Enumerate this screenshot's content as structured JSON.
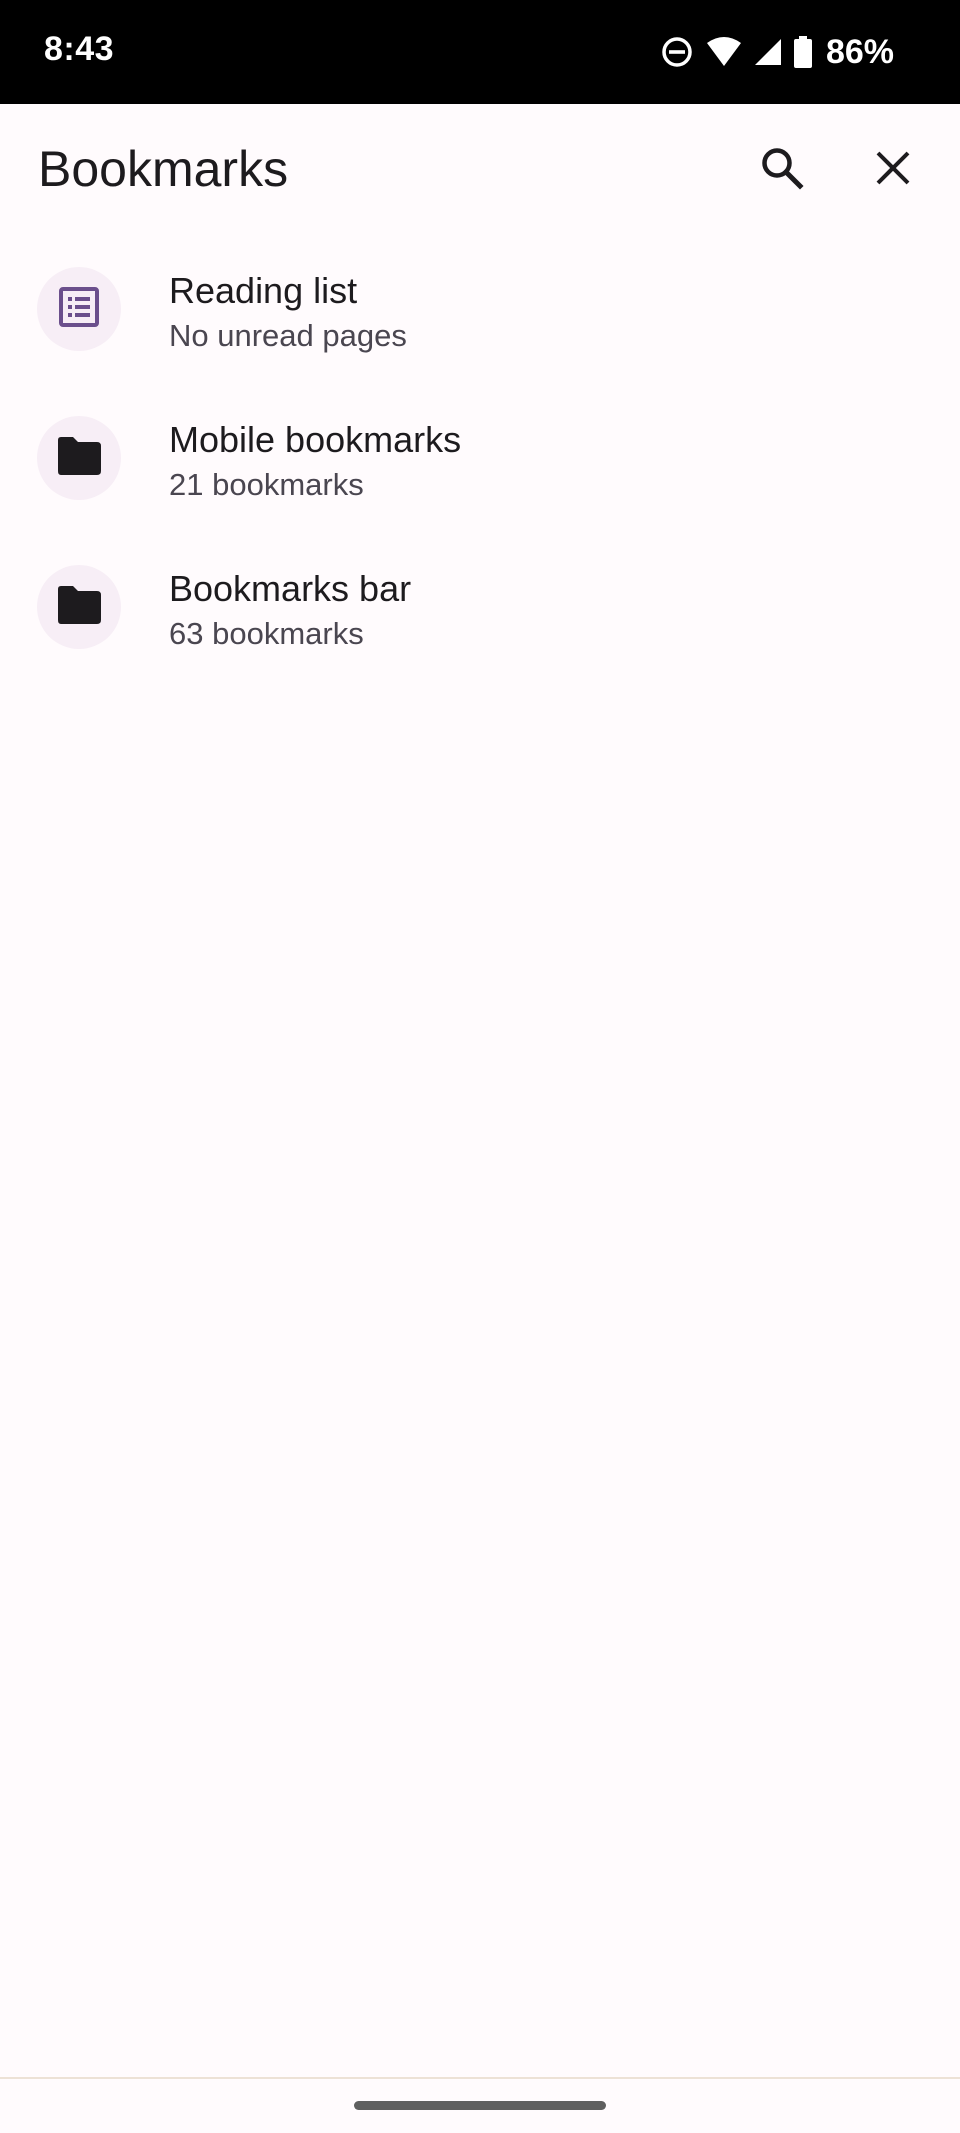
{
  "status_bar": {
    "time": "8:43",
    "battery_percent": "86%",
    "icons": [
      "do-not-disturb-icon",
      "wifi-icon",
      "cell-signal-icon",
      "battery-icon"
    ]
  },
  "app_bar": {
    "title": "Bookmarks",
    "actions": [
      "search-icon",
      "close-icon"
    ]
  },
  "folders": [
    {
      "title": "Reading list",
      "subtitle": "No unread pages",
      "icon": "reading-list-icon"
    },
    {
      "title": "Mobile bookmarks",
      "subtitle": "21 bookmarks",
      "icon": "folder-icon"
    },
    {
      "title": "Bookmarks bar",
      "subtitle": "63 bookmarks",
      "icon": "folder-icon"
    }
  ],
  "colors": {
    "background": "#fffbfd",
    "status_bar": "#000000",
    "icon_circle": "#f7eef6",
    "reading_list_accent": "#6b4f8c",
    "text_primary": "#1d1b1e",
    "text_secondary": "#4a4650"
  }
}
